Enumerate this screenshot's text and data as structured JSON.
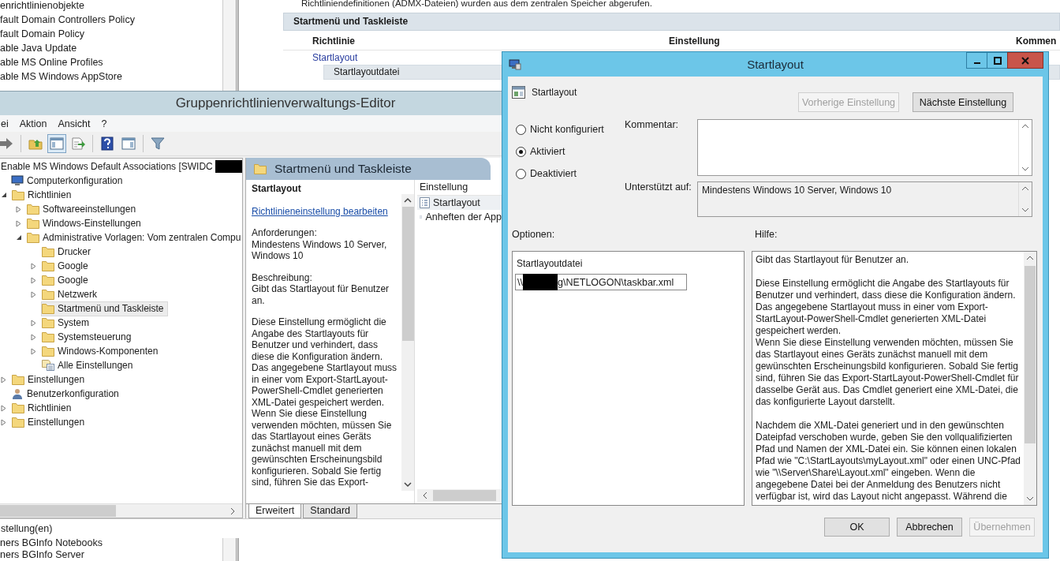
{
  "background_window": {
    "gpo_list_upper": [
      "enrichtlinienobjekte",
      "fault Domain Controllers Policy",
      "fault Domain Policy",
      "able Java Update",
      "able MS Online Profiles",
      "able MS Windows AppStore"
    ],
    "gpo_list_lower": [
      "ners BGInfo Notebooks",
      "ners BGInfo Server"
    ],
    "info_text": "Richtliniendefinitionen (ADMX-Dateien) wurden aus dem zentralen Speicher abgerufen.",
    "section_title": "Startmenü und Taskleiste",
    "columns": [
      "Richtlinie",
      "Einstellung",
      "Kommen"
    ],
    "rows": [
      {
        "label": "Startlayout",
        "kind": "link"
      },
      {
        "label": "Startlayoutdatei",
        "kind": "option"
      }
    ]
  },
  "editor": {
    "title": "Gruppenrichtlinienverwaltungs-Editor",
    "menu": [
      "ei",
      "Aktion",
      "Ansicht",
      "?"
    ],
    "toolbar": [
      {
        "kind": "forward",
        "pressed": false
      },
      {
        "kind": "up",
        "pressed": false
      },
      {
        "kind": "tree",
        "pressed": true
      },
      {
        "kind": "export",
        "pressed": false
      },
      {
        "kind": "help",
        "pressed": false
      },
      {
        "kind": "pane",
        "pressed": false
      },
      {
        "kind": "filter",
        "pressed": false
      }
    ],
    "tree": {
      "label": "Enable MS Windows Default Associations [SWIDC",
      "redacted": true,
      "selected": false,
      "children": [
        {
          "label": "Computerkonfiguration",
          "kind": "computer",
          "selected": false,
          "children": [
            {
              "label": "Richtlinien",
              "kind": "folder",
              "expanded": true,
              "selected": false,
              "children": [
                {
                  "label": "Softwareeinstellungen",
                  "kind": "folder",
                  "expanded": false,
                  "selected": false
                },
                {
                  "label": "Windows-Einstellungen",
                  "kind": "folder",
                  "expanded": false,
                  "selected": false
                },
                {
                  "label": "Administrative Vorlagen: Vom zentralen Compu",
                  "kind": "folder",
                  "expanded": true,
                  "selected": false,
                  "children": [
                    {
                      "label": "Drucker",
                      "kind": "folder",
                      "selected": false
                    },
                    {
                      "label": "Google",
                      "kind": "folder",
                      "expanded": false,
                      "selected": false
                    },
                    {
                      "label": "Google",
                      "kind": "folder",
                      "expanded": false,
                      "selected": false
                    },
                    {
                      "label": "Netzwerk",
                      "kind": "folder",
                      "expanded": false,
                      "selected": false
                    },
                    {
                      "label": "Startmenü und Taskleiste",
                      "kind": "folder",
                      "selected": true
                    },
                    {
                      "label": "System",
                      "kind": "folder",
                      "expanded": false,
                      "selected": false
                    },
                    {
                      "label": "Systemsteuerung",
                      "kind": "folder",
                      "expanded": false,
                      "selected": false
                    },
                    {
                      "label": "Windows-Komponenten",
                      "kind": "folder",
                      "expanded": false,
                      "selected": false
                    },
                    {
                      "label": "Alle Einstellungen",
                      "kind": "settings",
                      "selected": false
                    }
                  ]
                }
              ]
            },
            {
              "label": "Einstellungen",
              "kind": "folder",
              "expanded": false,
              "selected": false
            }
          ]
        },
        {
          "label": "Benutzerkonfiguration",
          "kind": "user",
          "selected": false,
          "children": [
            {
              "label": "Richtlinien",
              "kind": "folder",
              "expanded": false,
              "selected": false
            },
            {
              "label": "Einstellungen",
              "kind": "folder",
              "expanded": false,
              "selected": false
            }
          ]
        }
      ]
    },
    "status_bar": "stellung(en)",
    "details": {
      "header": "Startmenü und Taskleiste",
      "policy_title": "Startlayout",
      "edit_link": "Richtlinieneinstellung bearbeiten",
      "paragraphs": [
        "Anforderungen:\nMindestens Windows 10 Server, Windows 10",
        "Beschreibung:\nGibt das Startlayout für Benutzer an.",
        "Diese Einstellung ermöglicht die Angabe des Startlayouts für Benutzer und verhindert, dass diese die Konfiguration ändern. Das angegebene Startlayout muss in einer vom Export-StartLayout-PowerShell-Cmdlet generierten XML-Datei gespeichert werden. Wenn Sie diese Einstellung verwenden möchten, müssen Sie das Startlayout eines Geräts zunächst manuell mit dem gewünschten Erscheinungsbild konfigurieren. Sobald Sie fertig sind, führen Sie das Export-"
      ]
    },
    "list": {
      "column": "Einstellung",
      "items": [
        {
          "label": "Startlayout",
          "selected": true
        },
        {
          "label": "Anheften der App",
          "selected": false
        }
      ]
    },
    "view_tabs": [
      {
        "label": "Erweitert",
        "selected": true
      },
      {
        "label": "Standard",
        "selected": false
      }
    ]
  },
  "dialog": {
    "title": "Startlayout",
    "setting_name": "Startlayout",
    "nav_buttons": [
      {
        "label": "Vorherige Einstellung",
        "disabled": true
      },
      {
        "label": "Nächste Einstellung",
        "disabled": false
      }
    ],
    "state_options": [
      {
        "label": "Nicht konfiguriert",
        "selected": false
      },
      {
        "label": "Aktiviert",
        "selected": true
      },
      {
        "label": "Deaktiviert",
        "selected": false
      }
    ],
    "comment_label": "Kommentar:",
    "supported_label": "Unterstützt auf:",
    "supported_value": "Mindestens Windows 10 Server, Windows 10",
    "options_label": "Optionen:",
    "help_label": "Hilfe:",
    "option_field": {
      "label": "Startlayoutdatei",
      "value_start": "\\\\",
      "value_end": "g\\NETLOGON\\taskbar.xml",
      "redacted": true
    },
    "help_paragraphs": [
      "Gibt das Startlayout für Benutzer an.",
      "Diese Einstellung ermöglicht die Angabe des Startlayouts für Benutzer und verhindert, dass diese die Konfiguration ändern. Das angegebene Startlayout muss in einer vom Export-StartLayout-PowerShell-Cmdlet generierten XML-Datei gespeichert werden.\nWenn Sie diese Einstellung verwenden möchten, müssen Sie das Startlayout eines Geräts zunächst manuell mit dem gewünschten Erscheinungsbild konfigurieren. Sobald Sie fertig sind, führen Sie das Export-StartLayout-PowerShell-Cmdlet für dasselbe Gerät aus. Das Cmdlet generiert eine XML-Datei, die das konfigurierte Layout darstellt.",
      "Nachdem die XML-Datei generiert und in den gewünschten Dateipfad verschoben wurde, geben Sie den vollqualifizierten Pfad und Namen der XML-Datei ein. Sie können einen lokalen Pfad wie \"C:\\StartLayouts\\myLayout.xml\" oder einen UNC-Pfad wie \"\\\\Server\\Share\\Layout.xml\" eingeben. Wenn die angegebene Datei bei der Anmeldung des Benutzers nicht verfügbar ist, wird das Layout nicht angepasst. Während die"
    ],
    "buttons": [
      {
        "label": "OK",
        "disabled": false
      },
      {
        "label": "Abbrechen",
        "disabled": false
      },
      {
        "label": "Übernehmen",
        "disabled": true
      }
    ]
  }
}
